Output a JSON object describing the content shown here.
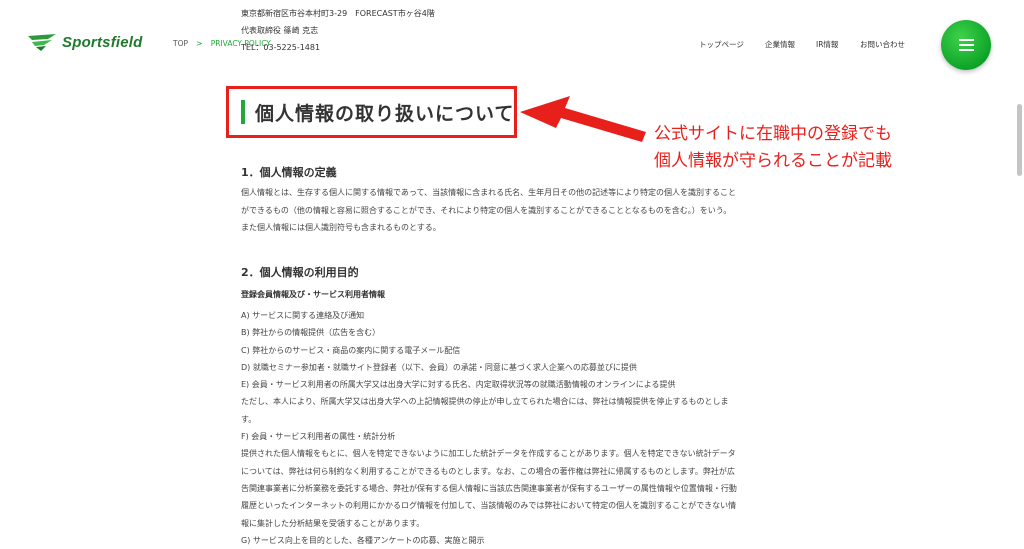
{
  "header": {
    "logo_text": "Sportsfield",
    "breadcrumb": {
      "top": "TOP",
      "sep": ">",
      "current": "PRIVACY POLICY"
    },
    "company": {
      "address": "東京都新宿区市谷本村町3-29　FORECAST市ヶ谷4階",
      "representative": "代表取締役 篠崎 克志",
      "tel": "TEL：03-5225-1481"
    },
    "nav": [
      "トップページ",
      "企業情報",
      "IR情報",
      "お問い合わせ"
    ]
  },
  "page": {
    "title": "個人情報の取り扱いについて",
    "annotation": [
      "公式サイトに在職中の登録でも",
      "個人情報が守られることが記載"
    ],
    "section1": {
      "heading": "1．個人情報の定義",
      "lines": [
        "個人情報とは、生存する個人に関する情報であって、当該情報に含まれる氏名、生年月日その他の記述等により特定の個人を識別すること",
        "ができるもの（他の情報と容易に照合することができ、それにより特定の個人を識別することができることとなるものを含む。）をいう。",
        "また個人情報には個人識別符号も含まれるものとする。"
      ]
    },
    "section2": {
      "heading": "2．個人情報の利用目的",
      "subheading": "登録会員情報及び・サービス利用者情報",
      "lines": [
        "A) サービスに関する連絡及び通知",
        "B) 弊社からの情報提供（広告を含む）",
        "C) 弊社からのサービス・商品の案内に関する電子メール配信",
        "D) 就職セミナー参加者・就職サイト登録者（以下、会員）の承諾・同意に基づく求人企業への応募並びに提供",
        "E) 会員・サービス利用者の所属大学又は出身大学に対する氏名、内定取得状況等の就職活動情報のオンラインによる提供",
        "ただし、本人により、所属大学又は出身大学への上記情報提供の停止が申し立てられた場合には、弊社は情報提供を停止するものとしま",
        "す。",
        "F) 会員・サービス利用者の属性・統計分析",
        "提供された個人情報をもとに、個人を特定できないように加工した統計データを作成することがあります。個人を特定できない統計データ",
        "については、弊社は何ら制約なく利用することができるものとします。なお、この場合の著作権は弊社に帰属するものとします。弊社が広",
        "告関連事業者に分析業務を委託する場合、弊社が保有する個人情報に当該広告関連事業者が保有するユーザーの属性情報や位置情報・行動",
        "履歴といったインターネットの利用にかかるログ情報を付加して、当該情報のみでは弊社において特定の個人を識別することができない情",
        "報に集計した分析結果を受領することがあります。",
        "G) サービス向上を目的とした、各種アンケートの応募、実施と開示"
      ]
    }
  },
  "colors": {
    "accent_green": "#22a83a",
    "highlight_red": "#e8201c"
  }
}
